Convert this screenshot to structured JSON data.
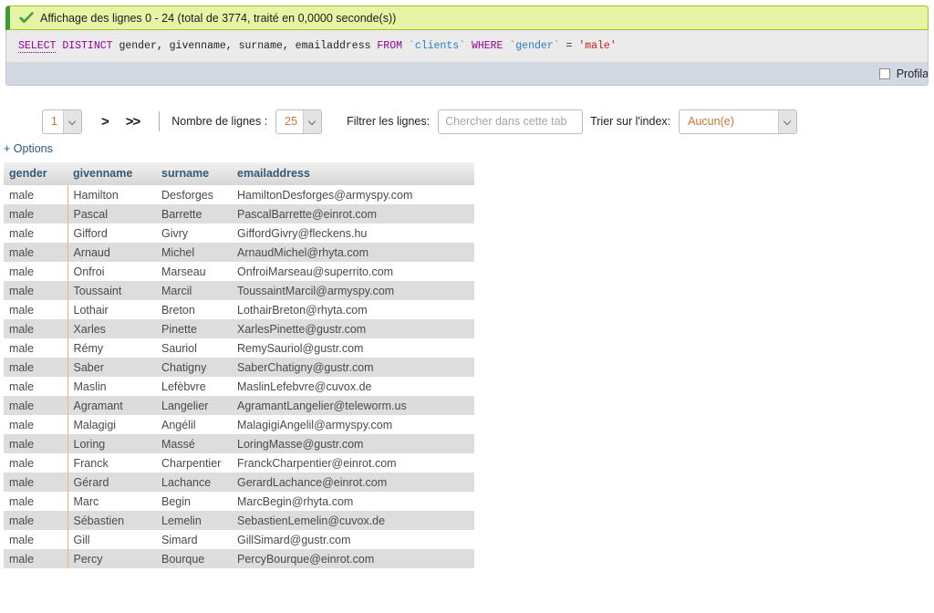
{
  "banner": {
    "icon": "check-icon",
    "text": "Affichage des lignes 0 - 24 (total de 3774, traité en 0,0000 seconde(s))"
  },
  "sql": {
    "tokens": [
      {
        "t": "SELECT",
        "c": "kw-sel"
      },
      {
        "t": " ",
        "c": "punct"
      },
      {
        "t": "DISTINCT",
        "c": "kw"
      },
      {
        "t": " gender, givenname, surname, emailaddress ",
        "c": "ident"
      },
      {
        "t": "FROM",
        "c": "kw"
      },
      {
        "t": " ",
        "c": "punct"
      },
      {
        "t": "`clients`",
        "c": "btick"
      },
      {
        "t": " ",
        "c": "punct"
      },
      {
        "t": "WHERE",
        "c": "kw"
      },
      {
        "t": " ",
        "c": "punct"
      },
      {
        "t": "`gender`",
        "c": "btick"
      },
      {
        "t": " = ",
        "c": "punct"
      },
      {
        "t": "'male'",
        "c": "strlit"
      }
    ],
    "plain": "SELECT DISTINCT gender, givenname, surname, emailaddress FROM `clients` WHERE `gender` = 'male'"
  },
  "sql_footer": {
    "profiling_label": "Profilage ["
  },
  "toolbar": {
    "page_value": "1",
    "next_page_label": ">",
    "last_page_label": ">>",
    "rows_count_label": "Nombre de lignes :",
    "rows_count_value": "25",
    "filter_label": "Filtrer les lignes:",
    "filter_value": "",
    "filter_placeholder": "Chercher dans cette tab",
    "sort_index_label": "Trier sur l'index:",
    "sort_index_value": "Aucun(e)"
  },
  "options": {
    "toggle_label": "+ Options"
  },
  "table": {
    "columns": [
      "gender",
      "givenname",
      "surname",
      "emailaddress"
    ],
    "rows": [
      [
        "male",
        "Hamilton",
        "Desforges",
        "HamiltonDesforges@armyspy.com"
      ],
      [
        "male",
        "Pascal",
        "Barrette",
        "PascalBarrette@einrot.com"
      ],
      [
        "male",
        "Gifford",
        "Givry",
        "GiffordGivry@fleckens.hu"
      ],
      [
        "male",
        "Arnaud",
        "Michel",
        "ArnaudMichel@rhyta.com"
      ],
      [
        "male",
        "Onfroi",
        "Marseau",
        "OnfroiMarseau@superrito.com"
      ],
      [
        "male",
        "Toussaint",
        "Marcil",
        "ToussaintMarcil@armyspy.com"
      ],
      [
        "male",
        "Lothair",
        "Breton",
        "LothairBreton@rhyta.com"
      ],
      [
        "male",
        "Xarles",
        "Pinette",
        "XarlesPinette@gustr.com"
      ],
      [
        "male",
        "Rémy",
        "Sauriol",
        "RemySauriol@gustr.com"
      ],
      [
        "male",
        "Saber",
        "Chatigny",
        "SaberChatigny@gustr.com"
      ],
      [
        "male",
        "Maslin",
        "Lefèbvre",
        "MaslinLefebvre@cuvox.de"
      ],
      [
        "male",
        "Agramant",
        "Langelier",
        "AgramantLangelier@teleworm.us"
      ],
      [
        "male",
        "Malagigi",
        "Angélil",
        "MalagigiAngelil@armyspy.com"
      ],
      [
        "male",
        "Loring",
        "Massé",
        "LoringMasse@gustr.com"
      ],
      [
        "male",
        "Franck",
        "Charpentier",
        "FranckCharpentier@einrot.com"
      ],
      [
        "male",
        "Gérard",
        "Lachance",
        "GerardLachance@einrot.com"
      ],
      [
        "male",
        "Marc",
        "Begin",
        "MarcBegin@rhyta.com"
      ],
      [
        "male",
        "Sébastien",
        "Lemelin",
        "SebastienLemelin@cuvox.de"
      ],
      [
        "male",
        "Gill",
        "Simard",
        "GillSimard@gustr.com"
      ],
      [
        "male",
        "Percy",
        "Bourque",
        "PercyBourque@einrot.com"
      ]
    ]
  },
  "colors": {
    "banner_bg": "#e5f5a5",
    "banner_border": "#a2c11a",
    "banner_accent": "#3c9b37",
    "sql_bg": "#ebebeb",
    "footer_bg": "#d3d9e3",
    "header_text": "#355a75",
    "row_alt_bg": "#dddddd",
    "gender_divider": "#f0b37a",
    "select_value": "#c87533",
    "link": "#235a81"
  }
}
